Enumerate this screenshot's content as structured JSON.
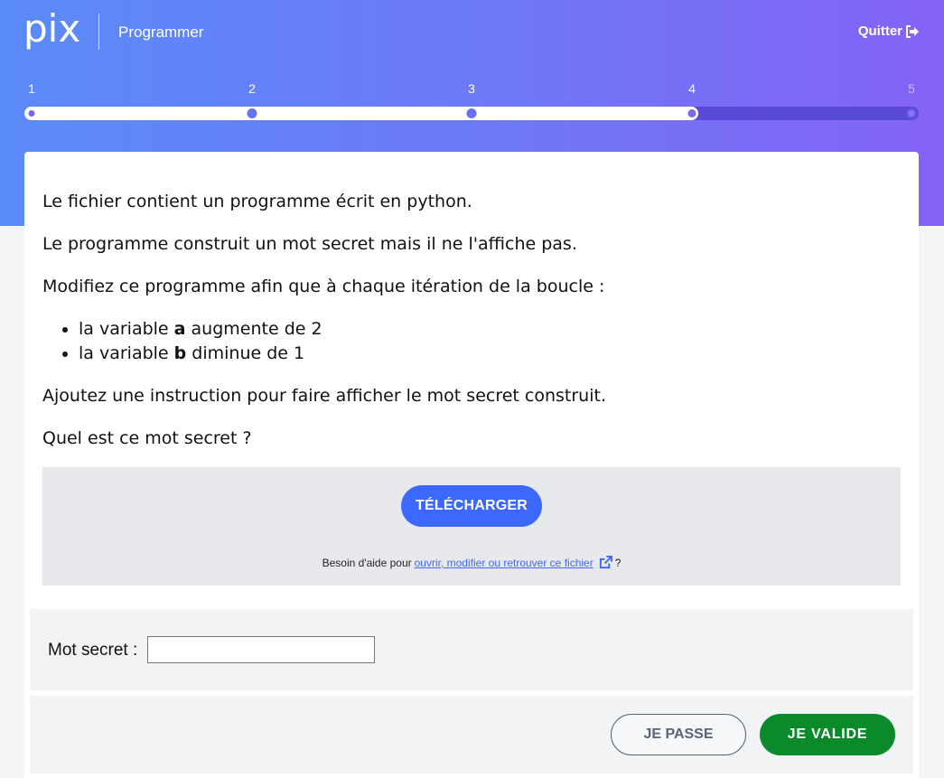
{
  "header": {
    "logo_text": "pix",
    "title": "Programmer",
    "quit_label": "Quitter"
  },
  "progress": {
    "steps": [
      "1",
      "2",
      "3",
      "4",
      "5"
    ],
    "current_step": 4,
    "total_steps": 5
  },
  "challenge": {
    "p1": "Le fichier contient un programme écrit en python.",
    "p2": "Le programme construit un mot secret mais il ne l'affiche pas.",
    "p3": "Modifiez ce programme afin que à chaque itération de la boucle :",
    "bullets": [
      {
        "pre": "la variable ",
        "bold": "a",
        "post": " augmente de 2"
      },
      {
        "pre": "la variable ",
        "bold": "b",
        "post": " diminue de 1"
      }
    ],
    "p4": "Ajoutez une instruction pour faire afficher le mot secret construit.",
    "p5": "Quel est ce mot secret ?"
  },
  "download": {
    "button_label": "TÉLÉCHARGER",
    "help_prefix": "Besoin d'aide pour",
    "help_link": "ouvrir, modifier ou retrouver ce fichier",
    "help_suffix": "?"
  },
  "answer": {
    "label": "Mot secret :",
    "value": ""
  },
  "actions": {
    "skip_label": "JE PASSE",
    "validate_label": "JE VALIDE"
  },
  "colors": {
    "primary": "#3d68ff",
    "validate": "#0b8a2c",
    "header_gradient_start": "#5a8bf8",
    "header_gradient_end": "#8462f6"
  }
}
